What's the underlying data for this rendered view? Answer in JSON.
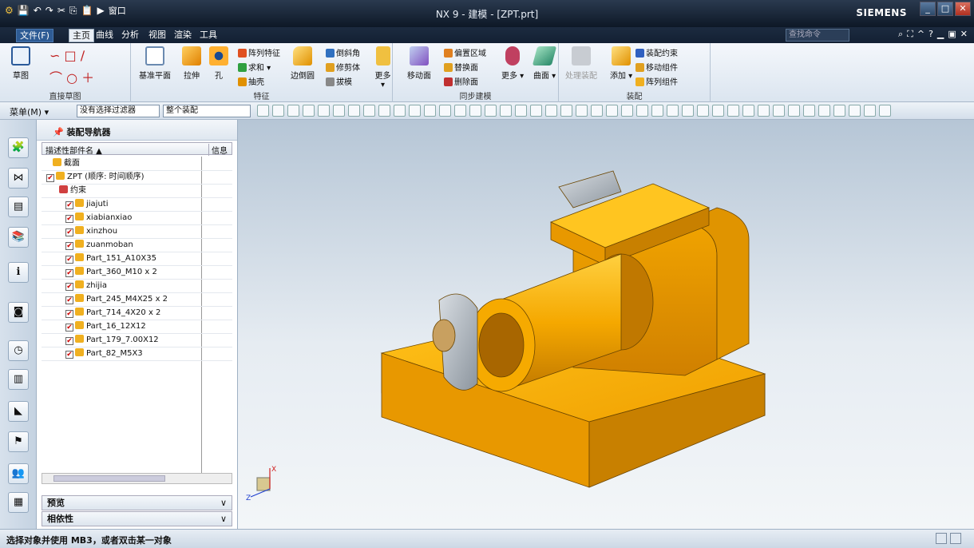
{
  "window": {
    "title": "NX 9 - 建模 - [ZPT.prt]",
    "brand": "SIEMENS",
    "qat_window_label": "窗口"
  },
  "menubar": {
    "file": "文件(F)",
    "tabs": [
      "主页",
      "曲线",
      "分析",
      "视图",
      "渲染",
      "工具"
    ],
    "search_placeholder": "查找命令"
  },
  "ribbon": {
    "direct_sketch": {
      "label": "直接草图",
      "sketch": "草图"
    },
    "feature": {
      "label": "特征",
      "datum_plane": "基准平面",
      "extrude": "拉伸",
      "hole": "孔",
      "pattern_feature": "阵列特征",
      "unite": "求和",
      "shell": "抽壳",
      "edge_blend": "边倒圆",
      "chamfer": "倒斜角",
      "trim_body": "修剪体",
      "draft": "拔模",
      "more": "更多"
    },
    "sync": {
      "label": "同步建模",
      "move_face": "移动面",
      "offset_region": "偏置区域",
      "replace_face": "替换面",
      "delete_face": "删除面",
      "more": "更多",
      "surface": "曲面"
    },
    "assembly": {
      "label": "装配",
      "process_assembly": "处理装配",
      "add": "添加",
      "assembly_constraints": "装配约束",
      "move_component": "移动组件",
      "pattern_component": "阵列组件"
    }
  },
  "toolbar": {
    "menu": "菜单(M)",
    "filter": "没有选择过滤器",
    "scope": "整个装配"
  },
  "navigator": {
    "title": "装配导航器",
    "col_name": "描述性部件名",
    "col_info": "信息",
    "rows": [
      {
        "label": "截面",
        "indent": 1,
        "check": false,
        "type": "folder"
      },
      {
        "label": "ZPT (顺序: 时间顺序)",
        "indent": 0,
        "check": true,
        "type": "assy"
      },
      {
        "label": "约束",
        "indent": 2,
        "check": false,
        "type": "constraint"
      },
      {
        "label": "jiajuti",
        "indent": 3,
        "check": true,
        "type": "part"
      },
      {
        "label": "xiabianxiao",
        "indent": 3,
        "check": true,
        "type": "part"
      },
      {
        "label": "xinzhou",
        "indent": 3,
        "check": true,
        "type": "part"
      },
      {
        "label": "zuanmoban",
        "indent": 3,
        "check": true,
        "type": "part"
      },
      {
        "label": "Part_151_A10X35",
        "indent": 3,
        "check": true,
        "type": "part"
      },
      {
        "label": "Part_360_M10 x 2",
        "indent": 3,
        "check": true,
        "type": "part"
      },
      {
        "label": "zhijia",
        "indent": 3,
        "check": true,
        "type": "part"
      },
      {
        "label": "Part_245_M4X25 x 2",
        "indent": 3,
        "check": true,
        "type": "part"
      },
      {
        "label": "Part_714_4X20 x 2",
        "indent": 3,
        "check": true,
        "type": "part"
      },
      {
        "label": "Part_16_12X12",
        "indent": 3,
        "check": true,
        "type": "part"
      },
      {
        "label": "Part_179_7.00X12",
        "indent": 3,
        "check": true,
        "type": "part"
      },
      {
        "label": "Part_82_M5X3",
        "indent": 3,
        "check": true,
        "type": "part"
      }
    ],
    "preview": "预览",
    "dependencies": "相依性"
  },
  "viewport": {
    "axis_x": "X",
    "axis_z": "Z"
  },
  "status": {
    "prompt": "选择对象并使用 MB3，或者双击某一对象"
  },
  "colors": {
    "part": "#f5a800",
    "part_dark": "#c07800",
    "gray_part": "#a8b0b8"
  }
}
